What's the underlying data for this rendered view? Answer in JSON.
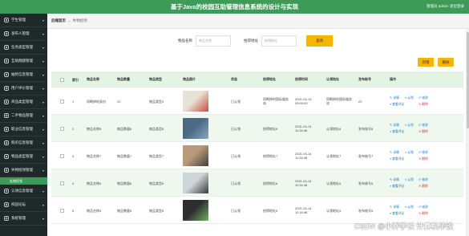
{
  "header": {
    "title": "基于Java的校园互助管理信息系统的设计与实现",
    "user": "管理员 admin",
    "logout": "退出登录"
  },
  "sidebar": {
    "items": [
      {
        "label": "学生管理",
        "icon": "user-icon"
      },
      {
        "label": "发布人管理",
        "icon": "user-icon"
      },
      {
        "label": "任务类型管理",
        "icon": "list-icon"
      },
      {
        "label": "互助跑腿管理",
        "icon": "run-icon"
      },
      {
        "label": "抽奖信息管理",
        "icon": "gift-icon"
      },
      {
        "label": "用户评价管理",
        "icon": "comment-icon"
      },
      {
        "label": "商品类型管理",
        "icon": "tag-icon"
      },
      {
        "label": "二手物品管理",
        "icon": "box-icon"
      },
      {
        "label": "职业信息管理",
        "icon": "briefcase-icon"
      },
      {
        "label": "购买信息管理",
        "icon": "cart-icon"
      },
      {
        "label": "物品类型管理",
        "icon": "folder-icon"
      },
      {
        "label": "失物招领管理",
        "icon": "search-icon"
      }
    ],
    "active_sub": "失物招领",
    "items_after": [
      {
        "label": "认领信息管理",
        "icon": "check-icon"
      },
      {
        "label": "校园论坛",
        "icon": "forum-icon"
      },
      {
        "label": "系统管理",
        "icon": "gear-icon"
      }
    ]
  },
  "breadcrumb": {
    "home": "后端首页",
    "sep": ">",
    "current": "失物招领"
  },
  "search": {
    "name_label": "物品名称",
    "name_placeholder": "物品名称",
    "addr_label": "拾得地址",
    "addr_placeholder": "拾得地址",
    "button": "查询"
  },
  "actions": {
    "add": "新增",
    "delete": "删除"
  },
  "table": {
    "headers": [
      "索引",
      "物品名称",
      "物品数量",
      "物品类型",
      "物品图片",
      "状态",
      "拾得地址",
      "拾得时间",
      "认领地址",
      "发布账号",
      "操作"
    ],
    "rows": [
      {
        "idx": "1",
        "name": "同断掉的身份",
        "qty": "22",
        "type": "物品类型3",
        "status": "已认领",
        "addr": "同断掉的国际服务站",
        "time": "2021-04-13 09:00:00",
        "claim": "同断掉的国际服务站",
        "acct": "22",
        "pic_colors": [
          "#e8e2d4",
          "#c64b3d"
        ]
      },
      {
        "idx": "2",
        "name": "物品名称8",
        "qty": "物品数量8",
        "type": "物品类型8",
        "status": "已认领",
        "addr": "拾得地址8",
        "time": "2021-04-14 11:34:48",
        "claim": "认领地址8",
        "acct": "发布账号8",
        "pic_colors": [
          "#4a6a84",
          "#8aa6bf"
        ]
      },
      {
        "idx": "3",
        "name": "物品名称7",
        "qty": "物品数量7",
        "type": "物品类型7",
        "status": "已认领",
        "addr": "拾得地址7",
        "time": "2021-04-14 11:34:48",
        "claim": "认领地址7",
        "acct": "发布账号7",
        "pic_colors": [
          "#b89a78",
          "#3f3f3f"
        ]
      },
      {
        "idx": "4",
        "name": "物品名称6",
        "qty": "物品数量6",
        "type": "物品类型6",
        "status": "已认领",
        "addr": "拾得地址6",
        "time": "2021-04-14 11:34:48",
        "claim": "认领地址6",
        "acct": "发布账号6",
        "pic_colors": [
          "#cfd6da",
          "#3a3a3a"
        ]
      },
      {
        "idx": "5",
        "name": "物品名称5",
        "qty": "物品数量5",
        "type": "物品类型5",
        "status": "已认领",
        "addr": "拾得地址5",
        "time": "2021-04-14 11:34:48",
        "claim": "认领地址5",
        "acct": "发布账号5",
        "pic_colors": [
          "#2e2e2e",
          "#6fb05a"
        ]
      }
    ],
    "ops": {
      "detail": "详情",
      "claim": "认领",
      "edit": "修改",
      "review": "查看评论",
      "delete": "删除"
    }
  },
  "watermark": "CSDN @小乔学长 计算机毕设"
}
